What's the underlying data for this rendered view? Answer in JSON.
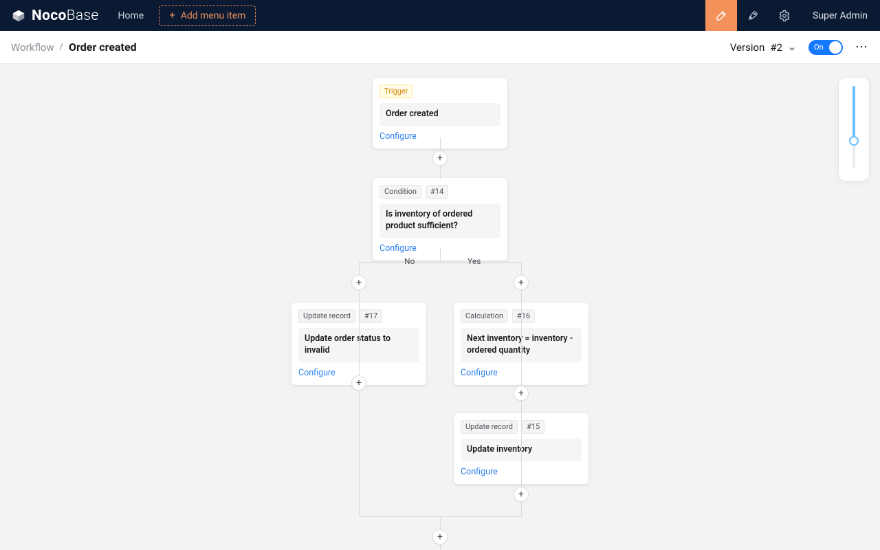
{
  "topbar": {
    "logo_bold": "Noco",
    "logo_light": "Base",
    "home": "Home",
    "add_menu": "Add menu item",
    "user": "Super Admin"
  },
  "subheader": {
    "crumb_root": "Workflow",
    "crumb_sep": "/",
    "crumb_current": "Order created",
    "version_label": "Version",
    "version_value": "#2",
    "toggle_label": "On",
    "more": "⋯"
  },
  "cards": {
    "trigger": {
      "tag": "Trigger",
      "title": "Order created",
      "action": "Configure"
    },
    "condition": {
      "tag": "Condition",
      "id": "#14",
      "title": "Is inventory of ordered product sufficient?",
      "action": "Configure"
    },
    "no_update": {
      "tag": "Update record",
      "id": "#17",
      "title": "Update order status to invalid",
      "action": "Configure"
    },
    "calc": {
      "tag": "Calculation",
      "id": "#16",
      "title": "Next inventory = inventory - ordered quantity",
      "action": "Configure"
    },
    "update_inv": {
      "tag": "Update record",
      "id": "#15",
      "title": "Update inventory",
      "action": "Configure"
    }
  },
  "branches": {
    "no": "No",
    "yes": "Yes"
  },
  "icons": {
    "plus": "+",
    "highlighter": "highlighter-icon",
    "rocket": "rocket-icon",
    "gear": "gear-icon",
    "chevron_down": "chevron-down"
  }
}
